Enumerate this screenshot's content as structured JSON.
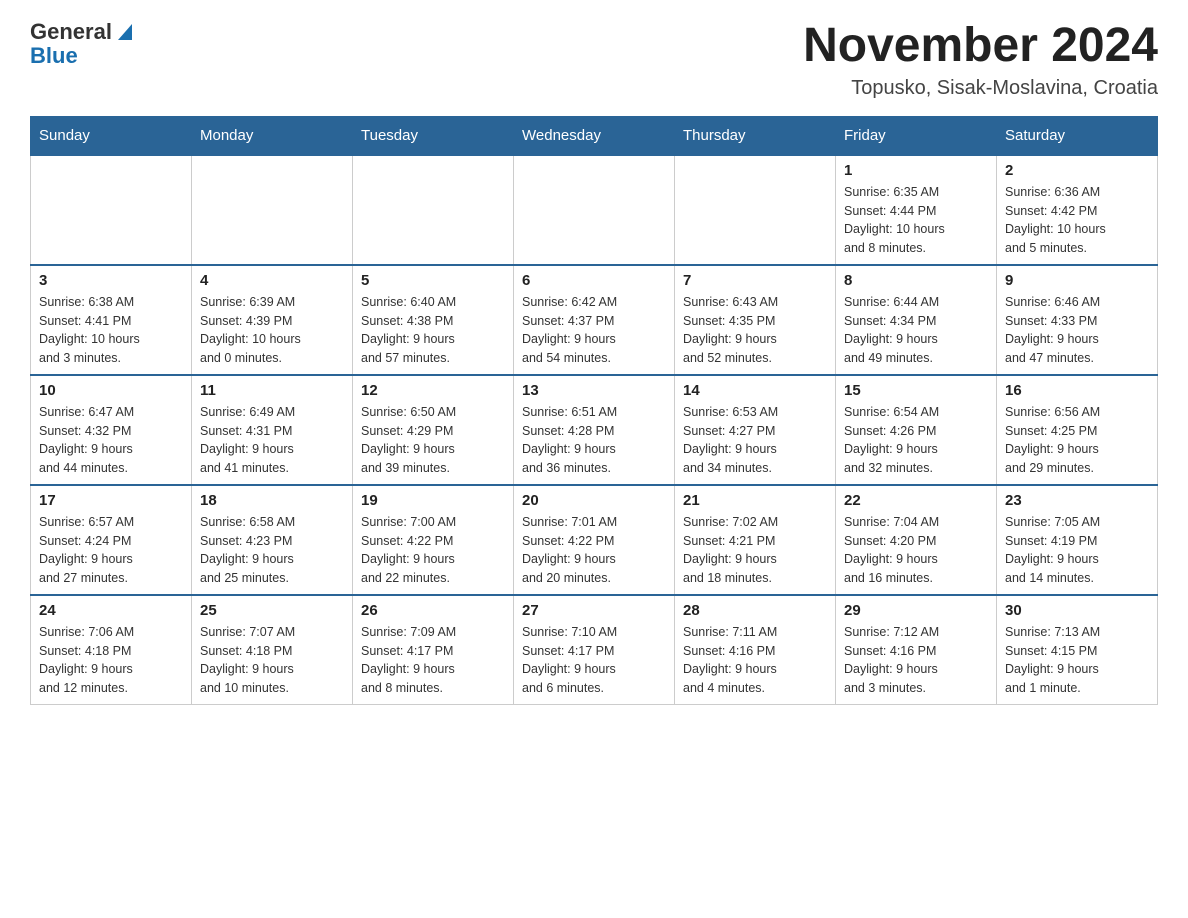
{
  "header": {
    "logo_general": "General",
    "logo_blue": "Blue",
    "title": "November 2024",
    "subtitle": "Topusko, Sisak-Moslavina, Croatia"
  },
  "weekdays": [
    "Sunday",
    "Monday",
    "Tuesday",
    "Wednesday",
    "Thursday",
    "Friday",
    "Saturday"
  ],
  "weeks": [
    {
      "days": [
        {
          "num": "",
          "info": ""
        },
        {
          "num": "",
          "info": ""
        },
        {
          "num": "",
          "info": ""
        },
        {
          "num": "",
          "info": ""
        },
        {
          "num": "",
          "info": ""
        },
        {
          "num": "1",
          "info": "Sunrise: 6:35 AM\nSunset: 4:44 PM\nDaylight: 10 hours\nand 8 minutes."
        },
        {
          "num": "2",
          "info": "Sunrise: 6:36 AM\nSunset: 4:42 PM\nDaylight: 10 hours\nand 5 minutes."
        }
      ]
    },
    {
      "days": [
        {
          "num": "3",
          "info": "Sunrise: 6:38 AM\nSunset: 4:41 PM\nDaylight: 10 hours\nand 3 minutes."
        },
        {
          "num": "4",
          "info": "Sunrise: 6:39 AM\nSunset: 4:39 PM\nDaylight: 10 hours\nand 0 minutes."
        },
        {
          "num": "5",
          "info": "Sunrise: 6:40 AM\nSunset: 4:38 PM\nDaylight: 9 hours\nand 57 minutes."
        },
        {
          "num": "6",
          "info": "Sunrise: 6:42 AM\nSunset: 4:37 PM\nDaylight: 9 hours\nand 54 minutes."
        },
        {
          "num": "7",
          "info": "Sunrise: 6:43 AM\nSunset: 4:35 PM\nDaylight: 9 hours\nand 52 minutes."
        },
        {
          "num": "8",
          "info": "Sunrise: 6:44 AM\nSunset: 4:34 PM\nDaylight: 9 hours\nand 49 minutes."
        },
        {
          "num": "9",
          "info": "Sunrise: 6:46 AM\nSunset: 4:33 PM\nDaylight: 9 hours\nand 47 minutes."
        }
      ]
    },
    {
      "days": [
        {
          "num": "10",
          "info": "Sunrise: 6:47 AM\nSunset: 4:32 PM\nDaylight: 9 hours\nand 44 minutes."
        },
        {
          "num": "11",
          "info": "Sunrise: 6:49 AM\nSunset: 4:31 PM\nDaylight: 9 hours\nand 41 minutes."
        },
        {
          "num": "12",
          "info": "Sunrise: 6:50 AM\nSunset: 4:29 PM\nDaylight: 9 hours\nand 39 minutes."
        },
        {
          "num": "13",
          "info": "Sunrise: 6:51 AM\nSunset: 4:28 PM\nDaylight: 9 hours\nand 36 minutes."
        },
        {
          "num": "14",
          "info": "Sunrise: 6:53 AM\nSunset: 4:27 PM\nDaylight: 9 hours\nand 34 minutes."
        },
        {
          "num": "15",
          "info": "Sunrise: 6:54 AM\nSunset: 4:26 PM\nDaylight: 9 hours\nand 32 minutes."
        },
        {
          "num": "16",
          "info": "Sunrise: 6:56 AM\nSunset: 4:25 PM\nDaylight: 9 hours\nand 29 minutes."
        }
      ]
    },
    {
      "days": [
        {
          "num": "17",
          "info": "Sunrise: 6:57 AM\nSunset: 4:24 PM\nDaylight: 9 hours\nand 27 minutes."
        },
        {
          "num": "18",
          "info": "Sunrise: 6:58 AM\nSunset: 4:23 PM\nDaylight: 9 hours\nand 25 minutes."
        },
        {
          "num": "19",
          "info": "Sunrise: 7:00 AM\nSunset: 4:22 PM\nDaylight: 9 hours\nand 22 minutes."
        },
        {
          "num": "20",
          "info": "Sunrise: 7:01 AM\nSunset: 4:22 PM\nDaylight: 9 hours\nand 20 minutes."
        },
        {
          "num": "21",
          "info": "Sunrise: 7:02 AM\nSunset: 4:21 PM\nDaylight: 9 hours\nand 18 minutes."
        },
        {
          "num": "22",
          "info": "Sunrise: 7:04 AM\nSunset: 4:20 PM\nDaylight: 9 hours\nand 16 minutes."
        },
        {
          "num": "23",
          "info": "Sunrise: 7:05 AM\nSunset: 4:19 PM\nDaylight: 9 hours\nand 14 minutes."
        }
      ]
    },
    {
      "days": [
        {
          "num": "24",
          "info": "Sunrise: 7:06 AM\nSunset: 4:18 PM\nDaylight: 9 hours\nand 12 minutes."
        },
        {
          "num": "25",
          "info": "Sunrise: 7:07 AM\nSunset: 4:18 PM\nDaylight: 9 hours\nand 10 minutes."
        },
        {
          "num": "26",
          "info": "Sunrise: 7:09 AM\nSunset: 4:17 PM\nDaylight: 9 hours\nand 8 minutes."
        },
        {
          "num": "27",
          "info": "Sunrise: 7:10 AM\nSunset: 4:17 PM\nDaylight: 9 hours\nand 6 minutes."
        },
        {
          "num": "28",
          "info": "Sunrise: 7:11 AM\nSunset: 4:16 PM\nDaylight: 9 hours\nand 4 minutes."
        },
        {
          "num": "29",
          "info": "Sunrise: 7:12 AM\nSunset: 4:16 PM\nDaylight: 9 hours\nand 3 minutes."
        },
        {
          "num": "30",
          "info": "Sunrise: 7:13 AM\nSunset: 4:15 PM\nDaylight: 9 hours\nand 1 minute."
        }
      ]
    }
  ]
}
